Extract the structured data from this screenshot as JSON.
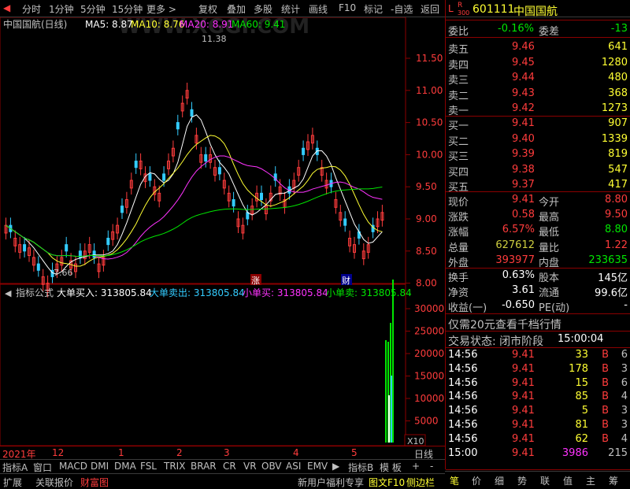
{
  "toolbar": {
    "items": [
      "分时",
      "1分钟",
      "5分钟",
      "15分钟",
      "更多 >",
      "复权",
      "叠加",
      "多股",
      "统计",
      "画线",
      "F10",
      "标记",
      "-自选",
      "返回"
    ]
  },
  "header": {
    "stock_name": "中国国航(日线)",
    "ma5": "MA5: 8.87",
    "ma10": "MA10: 8.76",
    "ma20": "MA20: 8.91",
    "ma60": "MA60: 9.41",
    "watermark": "WWW.XGGI.COM"
  },
  "price_axis": [
    "11.50",
    "11.00",
    "10.50",
    "10.00",
    "9.50",
    "9.00",
    "8.50",
    "8.00"
  ],
  "annotations": {
    "high": "11.38",
    "low": "7.66",
    "zhang": "涨",
    "cai": "财"
  },
  "indicator": {
    "label": "指标公式",
    "big_buy": "大单买入: 313805.84",
    "big_sell": "大单卖出: 313805.84",
    "small_buy": "小单买: 313805.84",
    "small_sell": "小单卖: 313805.84",
    "axis": [
      "30000",
      "25000",
      "20000",
      "15000",
      "10000",
      "5000"
    ],
    "unit": "X10"
  },
  "time_axis": {
    "labels": [
      "2021年",
      "12",
      "1",
      "2",
      "3",
      "4",
      "5"
    ],
    "period": "日线"
  },
  "bottom_tabs": [
    "指标A",
    "窗口",
    "MACD",
    "DMI",
    "DMA",
    "FSL",
    "TRIX",
    "BRAR",
    "CR",
    "VR",
    "OBV",
    "ASI",
    "EMV"
  ],
  "bottom_tabs_right": [
    "指标B",
    "模 板",
    "+",
    "-"
  ],
  "bottom_bar": [
    "扩展",
    "关联报价",
    "财富图"
  ],
  "bottom_right": [
    "新用户福利专享",
    "图文F10",
    "侧边栏"
  ],
  "rp_bottom_tabs": [
    "笔",
    "价",
    "细",
    "势",
    "联",
    "值",
    "主",
    "筹"
  ],
  "stock": {
    "lr": "L",
    "r": "R",
    "num": "300",
    "code": "601111",
    "name": "中国国航"
  },
  "weibi": {
    "label": "委比",
    "value": "-0.16%",
    "label2": "委差",
    "value2": "-13"
  },
  "sell": [
    {
      "label": "卖五",
      "price": "9.46",
      "vol": "641"
    },
    {
      "label": "卖四",
      "price": "9.45",
      "vol": "1280"
    },
    {
      "label": "卖三",
      "price": "9.44",
      "vol": "480"
    },
    {
      "label": "卖二",
      "price": "9.43",
      "vol": "368"
    },
    {
      "label": "卖一",
      "price": "9.42",
      "vol": "1273"
    }
  ],
  "buy": [
    {
      "label": "买一",
      "price": "9.41",
      "vol": "907"
    },
    {
      "label": "买二",
      "price": "9.40",
      "vol": "1339"
    },
    {
      "label": "买三",
      "price": "9.39",
      "vol": "819"
    },
    {
      "label": "买四",
      "price": "9.38",
      "vol": "547"
    },
    {
      "label": "买五",
      "price": "9.37",
      "vol": "417"
    }
  ],
  "quote": [
    {
      "l1": "现价",
      "v1": "9.41",
      "l2": "今开",
      "v2": "8.80"
    },
    {
      "l1": "涨跌",
      "v1": "0.58",
      "l2": "最高",
      "v2": "9.50"
    },
    {
      "l1": "涨幅",
      "v1": "6.57%",
      "l2": "最低",
      "v2": "8.80"
    },
    {
      "l1": "总量",
      "v1": "627612",
      "l2": "量比",
      "v2": "1.22"
    },
    {
      "l1": "外盘",
      "v1": "393977",
      "l2": "内盘",
      "v2": "233635"
    }
  ],
  "stats": [
    {
      "l1": "换手",
      "v1": "0.63%",
      "l2": "股本",
      "v2": "145亿"
    },
    {
      "l1": "净资",
      "v1": "3.61",
      "l2": "流通",
      "v2": "99.6亿"
    },
    {
      "l1": "收益(一)",
      "v1": "-0.650",
      "l2": "PE(动)",
      "v2": "-"
    }
  ],
  "promo": "仅需20元查看千档行情",
  "trade_status": {
    "label": "交易状态: 闭市阶段",
    "time": "15:00:04"
  },
  "ticks": [
    {
      "t": "14:56",
      "p": "9.41",
      "v": "33",
      "d": "B",
      "n": "6"
    },
    {
      "t": "14:56",
      "p": "9.41",
      "v": "178",
      "d": "B",
      "n": "3"
    },
    {
      "t": "14:56",
      "p": "9.41",
      "v": "15",
      "d": "B",
      "n": "6"
    },
    {
      "t": "14:56",
      "p": "9.41",
      "v": "85",
      "d": "B",
      "n": "4"
    },
    {
      "t": "14:56",
      "p": "9.41",
      "v": "5",
      "d": "B",
      "n": "3"
    },
    {
      "t": "14:56",
      "p": "9.41",
      "v": "81",
      "d": "B",
      "n": "3"
    },
    {
      "t": "14:56",
      "p": "9.41",
      "v": "62",
      "d": "B",
      "n": "4"
    },
    {
      "t": "15:00",
      "p": "9.41",
      "v": "3986",
      "d": "",
      "n": "215"
    }
  ]
}
